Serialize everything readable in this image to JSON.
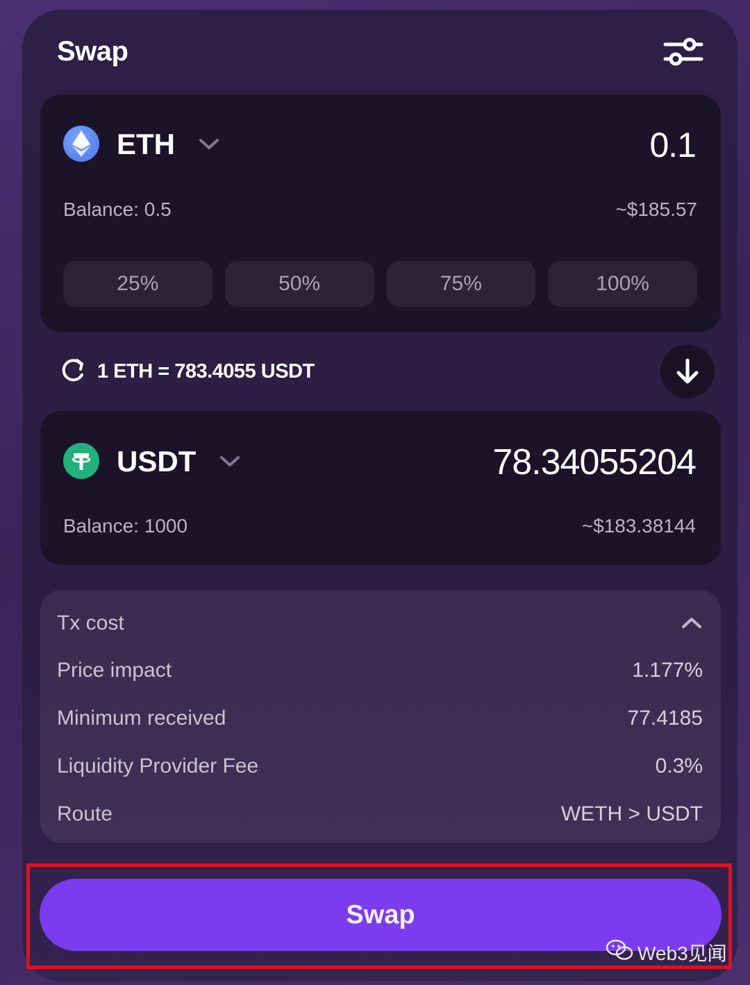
{
  "header": {
    "title": "Swap",
    "settings_icon": "sliders-icon"
  },
  "from": {
    "token": "ETH",
    "icon": "ethereum-icon",
    "amount": "0.1",
    "balance": "Balance: 0.5",
    "usd_value": "~$185.57",
    "percent_buttons": [
      "25%",
      "50%",
      "75%",
      "100%"
    ]
  },
  "rate": {
    "icon": "refresh-icon",
    "text": "1 ETH = 783.4055 USDT"
  },
  "to": {
    "token": "USDT",
    "icon": "tether-icon",
    "amount": "78.34055204",
    "balance": "Balance: 1000",
    "usd_value": "~$183.38144"
  },
  "details": {
    "header": "Tx cost",
    "rows": [
      {
        "label": "Price impact",
        "value": "1.177%"
      },
      {
        "label": "Minimum received",
        "value": "77.4185"
      },
      {
        "label": "Liquidity Provider Fee",
        "value": "0.3%"
      },
      {
        "label": "Route",
        "value": "WETH > USDT"
      }
    ]
  },
  "action": {
    "swap_label": "Swap"
  },
  "watermark": {
    "text": "Web3见闻"
  },
  "colors": {
    "accent": "#7b3cf0",
    "highlight": "#e0101f",
    "panel": "#1b1429",
    "usdt_green": "#22b07d",
    "eth_blue": "#5b82ee"
  }
}
